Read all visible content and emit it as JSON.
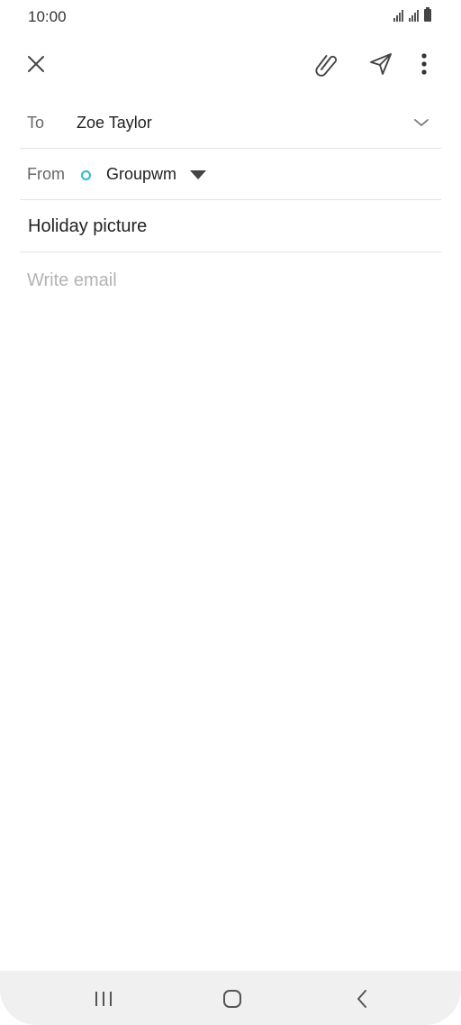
{
  "status_bar": {
    "time": "10:00"
  },
  "toolbar": {
    "close_icon": "close-icon",
    "attach_icon": "paperclip-icon",
    "send_icon": "send-icon",
    "more_icon": "more-vertical-icon"
  },
  "compose": {
    "to_label": "To",
    "to_value": "Zoe Taylor",
    "from_label": "From",
    "from_value": "Groupwm",
    "subject_value": "Holiday picture",
    "body_placeholder": "Write email",
    "account_dot_color": "#2db7d6"
  },
  "navbar": {
    "recents_icon": "recents-icon",
    "home_icon": "home-icon",
    "back_icon": "back-icon"
  }
}
